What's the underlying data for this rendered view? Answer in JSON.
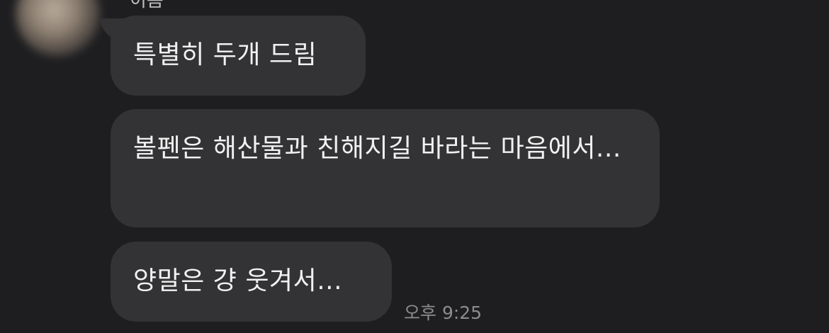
{
  "conversation": {
    "sender_name": "이름",
    "messages": [
      {
        "text": "특별히 두개 드림"
      },
      {
        "text": "볼펜은 해산물과 친해지길 바라는 마음에서..."
      },
      {
        "text": "양말은 걍 웃겨서..."
      }
    ],
    "timestamp": "오후 9:25"
  }
}
